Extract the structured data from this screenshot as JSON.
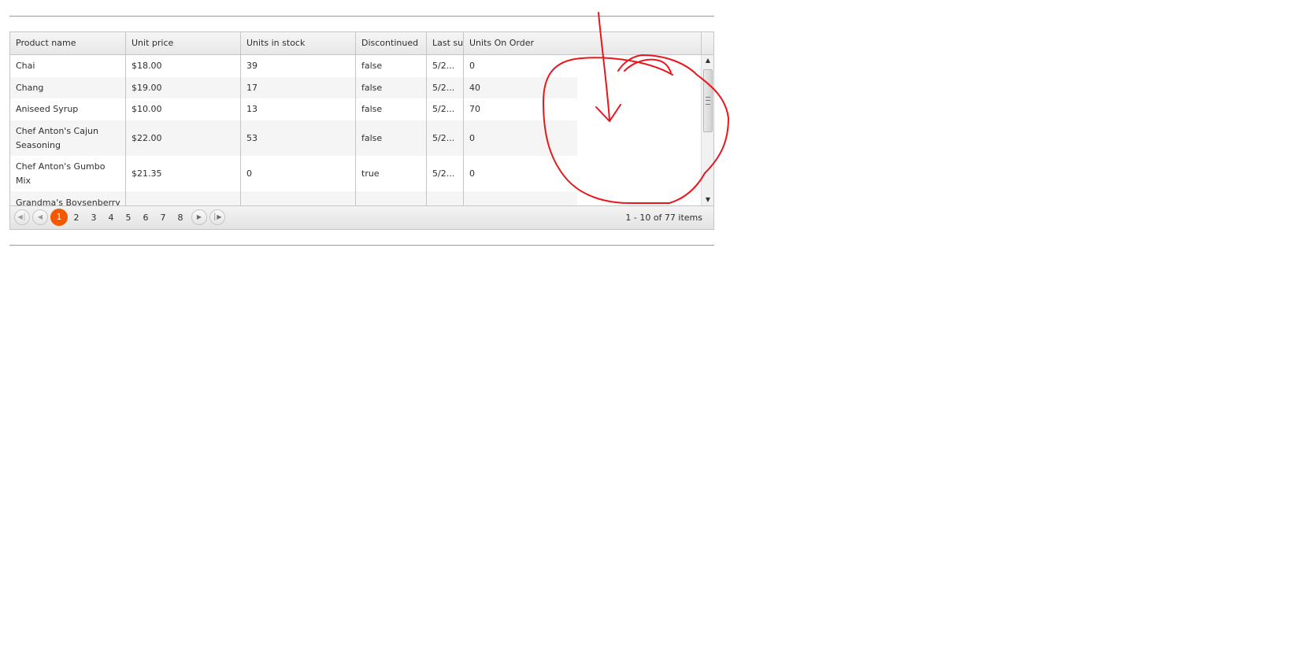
{
  "grid": {
    "columns": [
      "Product name",
      "Unit price",
      "Units in stock",
      "Discontinued",
      "Last su",
      "Units On Order"
    ],
    "rows": [
      {
        "name": "Chai",
        "price": "$18.00",
        "stock": "39",
        "discontinued": "false",
        "last_supply": "5/2...",
        "on_order": "0"
      },
      {
        "name": "Chang",
        "price": "$19.00",
        "stock": "17",
        "discontinued": "false",
        "last_supply": "5/2...",
        "on_order": "40"
      },
      {
        "name": "Aniseed Syrup",
        "price": "$10.00",
        "stock": "13",
        "discontinued": "false",
        "last_supply": "5/2...",
        "on_order": "70"
      },
      {
        "name": "Chef Anton's Cajun Seasoning",
        "price": "$22.00",
        "stock": "53",
        "discontinued": "false",
        "last_supply": "5/2...",
        "on_order": "0"
      },
      {
        "name": "Chef Anton's Gumbo Mix",
        "price": "$21.35",
        "stock": "0",
        "discontinued": "true",
        "last_supply": "5/2...",
        "on_order": "0"
      },
      {
        "name": "Grandma's Boysenberry",
        "price": "",
        "stock": "",
        "discontinued": "",
        "last_supply": "",
        "on_order": ""
      }
    ]
  },
  "pager": {
    "pages": [
      "1",
      "2",
      "3",
      "4",
      "5",
      "6",
      "7",
      "8"
    ],
    "current_page": "1",
    "info": "1 - 10 of 77 items",
    "icons": {
      "first": "first-page-icon",
      "prev": "prev-page-icon",
      "next": "next-page-icon",
      "last": "last-page-icon"
    }
  },
  "scrollbar": {
    "icons": {
      "up": "scroll-up-icon",
      "down": "scroll-down-icon",
      "thumb": "scroll-thumb-grip-icon"
    }
  },
  "annotation": {
    "color": "#e8161d",
    "shape": "hand-drawn circle with arrow"
  }
}
